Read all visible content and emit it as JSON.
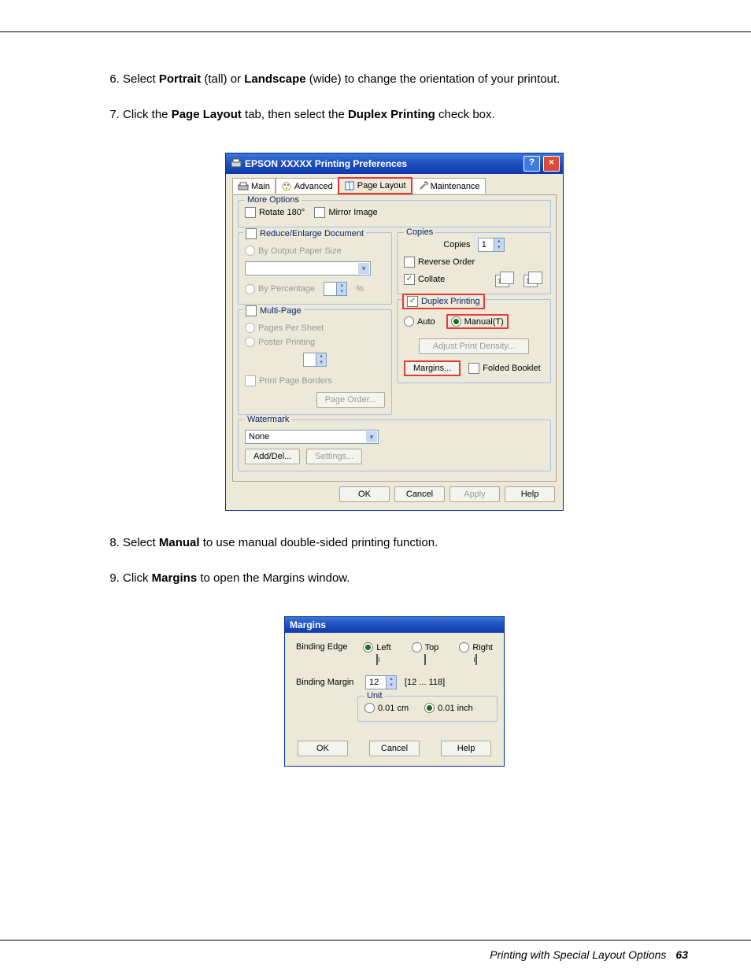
{
  "steps": {
    "s6": {
      "num": "6.",
      "pre": "Select ",
      "b1": "Portrait",
      "mid1": " (tall) or ",
      "b2": "Landscape",
      "post": " (wide) to change the orientation of your printout."
    },
    "s7": {
      "num": "7.",
      "pre": "Click the ",
      "b1": "Page Layout",
      "mid1": " tab, then select the ",
      "b2": "Duplex Printing",
      "post": " check box."
    },
    "s8": {
      "num": "8.",
      "pre": "Select ",
      "b1": "Manual",
      "post": " to use manual double-sided printing function."
    },
    "s9": {
      "num": "9.",
      "pre": "Click ",
      "b1": "Margins",
      "post": " to open the Margins window."
    }
  },
  "dlg1": {
    "title": "EPSON  XXXXX  Printing Preferences",
    "help": "?",
    "close": "×",
    "tabs": {
      "main": "Main",
      "advanced": "Advanced",
      "page_layout": "Page Layout",
      "maintenance": "Maintenance"
    },
    "more_options": {
      "legend": "More Options",
      "rotate": "Rotate 180°",
      "mirror": "Mirror Image"
    },
    "reduce": {
      "legend": "Reduce/Enlarge Document",
      "by_output": "By Output Paper Size",
      "by_percentage": "By Percentage",
      "pct": "%"
    },
    "multipage": {
      "legend": "Multi-Page",
      "pages_per_sheet": "Pages Per Sheet",
      "poster": "Poster Printing",
      "print_borders": "Print Page Borders",
      "page_order": "Page Order..."
    },
    "copies": {
      "legend": "Copies",
      "label": "Copies",
      "value": "1",
      "reverse": "Reverse Order",
      "collate": "Collate"
    },
    "duplex": {
      "legend": "Duplex Printing",
      "auto": "Auto",
      "manual": "Manual(T)",
      "adjust": "Adjust Print Density...",
      "margins": "Margins...",
      "folded": "Folded Booklet"
    },
    "watermark": {
      "legend": "Watermark",
      "value": "None",
      "add_del": "Add/Del...",
      "settings": "Settings..."
    },
    "buttons": {
      "ok": "OK",
      "cancel": "Cancel",
      "apply": "Apply",
      "help": "Help"
    }
  },
  "dlg2": {
    "title": "Margins",
    "binding_edge": "Binding Edge",
    "left": "Left",
    "top": "Top",
    "right": "Right",
    "binding_margin": "Binding Margin",
    "value": "12",
    "range": "[12 ... 118]",
    "unit": {
      "legend": "Unit",
      "cm": "0.01 cm",
      "inch": "0.01 inch"
    },
    "buttons": {
      "ok": "OK",
      "cancel": "Cancel",
      "help": "Help"
    }
  },
  "footer": {
    "text": "Printing with Special Layout Options",
    "page": "63"
  }
}
